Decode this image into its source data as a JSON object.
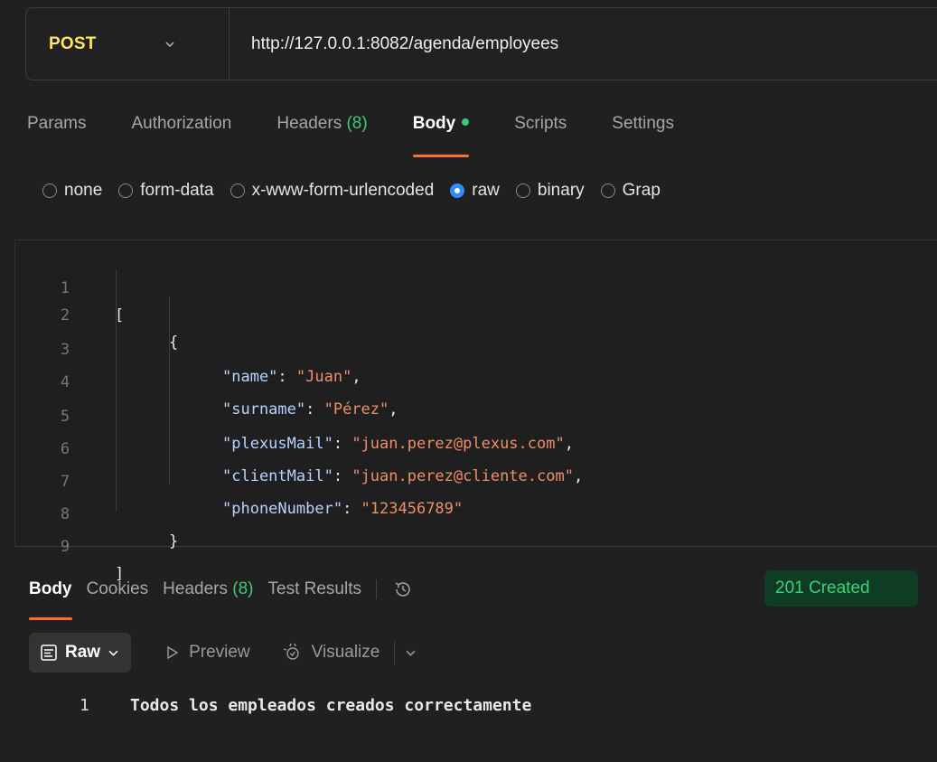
{
  "request": {
    "method": "POST",
    "url": "http://127.0.0.1:8082/agenda/employees"
  },
  "request_tabs": [
    {
      "label": "Params"
    },
    {
      "label": "Authorization"
    },
    {
      "label": "Headers",
      "count": "(8)"
    },
    {
      "label": "Body",
      "active": true,
      "indicator": "dot"
    },
    {
      "label": "Scripts"
    },
    {
      "label": "Settings"
    }
  ],
  "body_types": [
    {
      "label": "none",
      "selected": false
    },
    {
      "label": "form-data",
      "selected": false
    },
    {
      "label": "x-www-form-urlencoded",
      "selected": false
    },
    {
      "label": "raw",
      "selected": true
    },
    {
      "label": "binary",
      "selected": false
    },
    {
      "label": "Grap",
      "selected": false
    }
  ],
  "editor": {
    "line_numbers": [
      "1",
      "2",
      "3",
      "4",
      "5",
      "6",
      "7",
      "8",
      "9"
    ],
    "open_bracket": "[",
    "open_brace": "{",
    "fields": [
      {
        "key": "\"name\"",
        "value": "\"Juan\"",
        "trail": ","
      },
      {
        "key": "\"surname\"",
        "value": "\"Pérez\"",
        "trail": ","
      },
      {
        "key": "\"plexusMail\"",
        "value": "\"juan.perez@plexus.com\"",
        "trail": ","
      },
      {
        "key": "\"clientMail\"",
        "value": "\"juan.perez@cliente.com\"",
        "trail": ","
      },
      {
        "key": "\"phoneNumber\"",
        "value": "\"123456789\"",
        "trail": ""
      }
    ],
    "close_brace": "}",
    "close_bracket": "]"
  },
  "response_tabs": [
    {
      "label": "Body",
      "active": true
    },
    {
      "label": "Cookies"
    },
    {
      "label": "Headers",
      "count": "(8)"
    },
    {
      "label": "Test Results"
    }
  ],
  "status": {
    "text": "201 Created",
    "color": "#3ecf7a"
  },
  "response_toolbar": {
    "format": "Raw",
    "preview": "Preview",
    "visualize": "Visualize"
  },
  "response_body": {
    "line_number": "1",
    "text": "Todos los empleados creados correctamente"
  },
  "colors": {
    "method": "#ffe45c",
    "accent": "#ff6c37",
    "success": "#3ec879",
    "radio_selected": "#2f8cff"
  },
  "icons": [
    "chevron-down-icon",
    "history-icon",
    "raw-format-icon",
    "play-icon",
    "visualize-icon"
  ]
}
